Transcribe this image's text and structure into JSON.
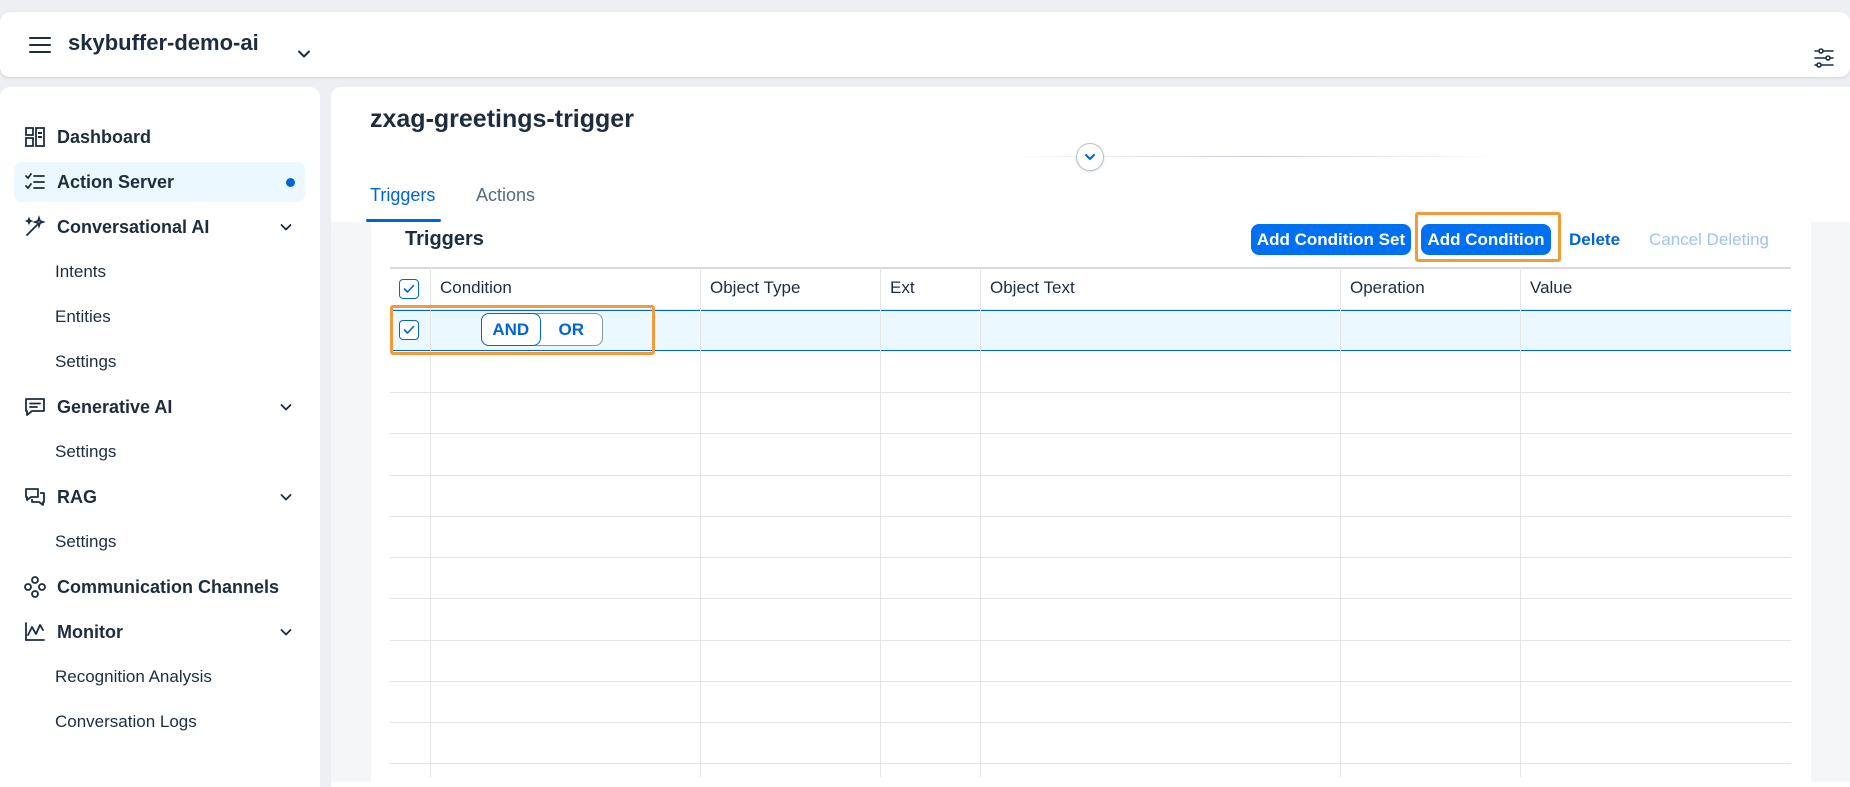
{
  "header": {
    "app_title": "skybuffer-demo-ai"
  },
  "sidebar": {
    "items": [
      {
        "label": "Dashboard"
      },
      {
        "label": "Action Server"
      },
      {
        "label": "Conversational AI"
      },
      {
        "label": "Intents"
      },
      {
        "label": "Entities"
      },
      {
        "label": "Settings"
      },
      {
        "label": "Generative AI"
      },
      {
        "label": "Settings"
      },
      {
        "label": "RAG"
      },
      {
        "label": "Settings"
      },
      {
        "label": "Communication Channels"
      },
      {
        "label": "Monitor"
      },
      {
        "label": "Recognition Analysis"
      },
      {
        "label": "Conversation Logs"
      }
    ]
  },
  "page": {
    "title": "zxag-greetings-trigger",
    "tabs": [
      {
        "label": "Triggers"
      },
      {
        "label": "Actions"
      }
    ]
  },
  "table": {
    "title": "Triggers",
    "toolbar": {
      "add_condition_set": "Add Condition Set",
      "add_condition": "Add Condition",
      "delete": "Delete",
      "cancel_deleting": "Cancel Deleting"
    },
    "columns": [
      "Condition",
      "Object Type",
      "Ext",
      "Object Text",
      "Operation",
      "Value"
    ],
    "row": {
      "and_label": "AND",
      "or_label": "OR"
    }
  },
  "colors": {
    "accent": "#0064d9",
    "emphasized_button": "#0070f2",
    "highlight": "#f39b3b",
    "selected_row": "#ebf8ff"
  }
}
